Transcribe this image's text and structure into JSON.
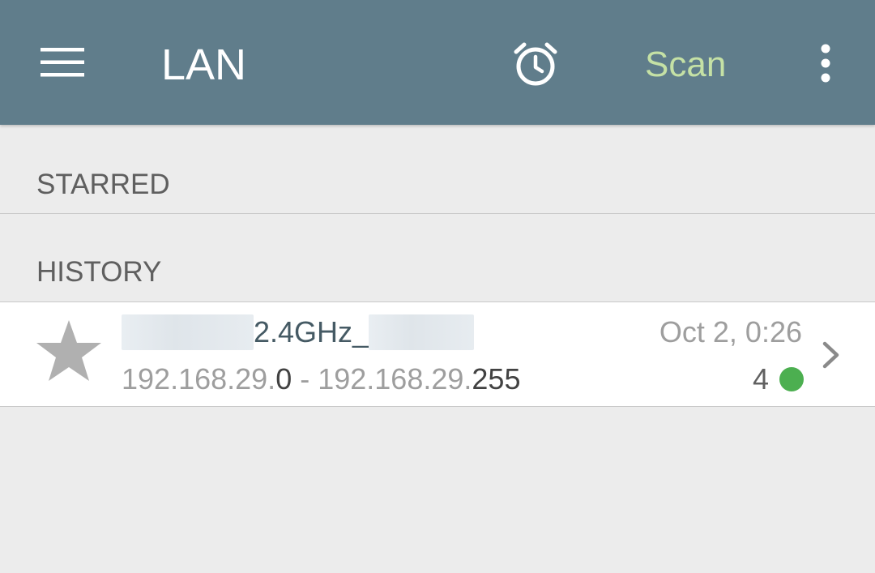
{
  "appbar": {
    "title": "LAN",
    "scan_label": "Scan",
    "colors": {
      "background": "#607d8b",
      "scan": "#c5e1a5"
    },
    "icons": [
      "menu-icon",
      "alarm-clock-icon",
      "more-vert-icon"
    ]
  },
  "sections": {
    "starred_label": "STARRED",
    "history_label": "HISTORY"
  },
  "history": [
    {
      "ssid_visible": "2.4GHz_",
      "range_prefix_start": "192.168.29.",
      "range_start_octet": "0",
      "range_separator": " - ",
      "range_prefix_end": "192.168.29.",
      "range_end_octet": "255",
      "date": "Oct 2, 0:26",
      "device_count": "4",
      "status_color": "#4caf50",
      "icons": [
        "star-icon",
        "chevron-right-icon"
      ]
    }
  ]
}
